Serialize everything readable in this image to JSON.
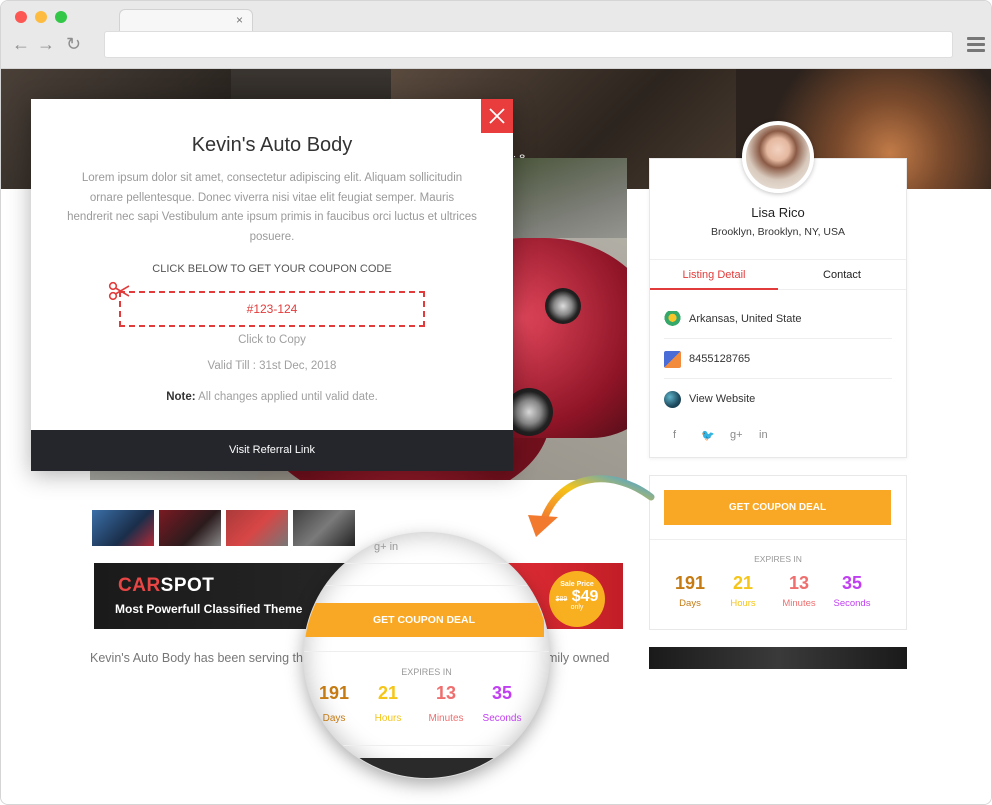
{
  "browser": {
    "tab_close": "×",
    "nav": {
      "back": "←",
      "forward": "→",
      "reload": "↻"
    }
  },
  "hero": {
    "text": ": 8"
  },
  "banner": {
    "logo_a": "CAR",
    "logo_b": "SPOT",
    "tagline": "Most Powerfull Classified Theme",
    "badge": {
      "label": "Sale Price",
      "old_price": "$89",
      "new_price": "$49",
      "only": "only"
    }
  },
  "body": {
    "text": "Kevin's Auto Body has been serving the",
    "tail": "amily owned"
  },
  "profile": {
    "name": "Lisa Rico",
    "location": "Brooklyn, Brooklyn, NY, USA",
    "tabs": [
      {
        "label": "Listing Detail"
      },
      {
        "label": "Contact"
      }
    ],
    "details": [
      {
        "icon": "map-pin-icon",
        "text": "Arkansas, United State"
      },
      {
        "icon": "phone-icon",
        "text": "8455128765"
      },
      {
        "icon": "globe-icon",
        "text": "View Website"
      }
    ],
    "socials": {
      "facebook": "f",
      "twitter": "🐦",
      "google": "g+",
      "linkedin": "in"
    }
  },
  "coupon": {
    "button": "GET COUPON DEAL",
    "expires_label": "EXPIRES IN",
    "countdown": [
      {
        "value": "191",
        "label": "Days",
        "color": "#c57a12"
      },
      {
        "value": "21",
        "label": "Hours",
        "color": "#f5c518"
      },
      {
        "value": "13",
        "label": "Minutes",
        "color": "#ef6f6f"
      },
      {
        "value": "35",
        "label": "Seconds",
        "color": "#c13ff2"
      }
    ]
  },
  "magnifier": {
    "socials": "g+   in",
    "button": "GET COUPON DEAL",
    "expires_label": "EXPIRES IN"
  },
  "modal": {
    "title": "Kevin's Auto Body",
    "description": "Lorem ipsum dolor sit amet, consectetur adipiscing elit. Aliquam sollicitudin ornare pellentesque. Donec viverra nisi vitae elit feugiat semper. Mauris hendrerit nec sapi Vestibulum ante ipsum primis in faucibus orci luctus et ultrices posuere.",
    "cta": "CLICK BELOW TO GET YOUR COUPON CODE",
    "code": "#123-124",
    "click_copy": "Click to Copy",
    "valid_till": "Valid Till : 31st Dec, 2018",
    "note_label": "Note:",
    "note_text": " All changes applied until valid date.",
    "footer": "Visit Referral Link"
  },
  "colors": {
    "accent_red": "#e23b3b",
    "coupon_orange": "#f9a825",
    "modal_footer": "#24262c"
  }
}
